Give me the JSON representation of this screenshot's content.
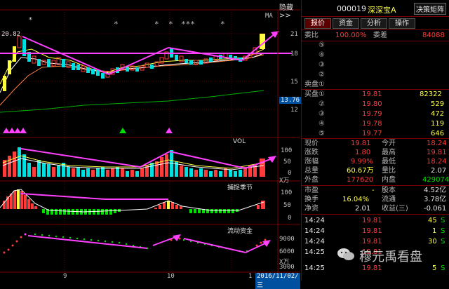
{
  "chart_header": {
    "collapse_label": "隐藏 >>"
  },
  "main_chart": {
    "price_labels": [
      "21",
      "18",
      "15",
      "12"
    ],
    "current_price_tag": "13.76",
    "high_marker": "20.82",
    "corner_label": "MA",
    "star_marks": [
      "*",
      "*",
      "*",
      "*",
      "***",
      "*"
    ]
  },
  "indicators": {
    "volume": {
      "title": "VOL",
      "ticks": [
        "100",
        "50",
        "0"
      ],
      "unit": "X万"
    },
    "seasonal": {
      "title": "捕捉季节",
      "ticks": [
        "100",
        "50",
        "0"
      ]
    },
    "capital": {
      "title": "流动资金",
      "ticks": [
        "9000",
        "6000",
        "3000"
      ],
      "unit": "X万"
    }
  },
  "x_axis": {
    "labels": [
      "9",
      "10",
      "1"
    ],
    "date_tag": "2016/11/02/三"
  },
  "stock": {
    "code": "000019",
    "name": "深深宝A",
    "decision_button": "决策矩阵"
  },
  "tabs": [
    {
      "label": "报价",
      "active": true
    },
    {
      "label": "资金",
      "active": false
    },
    {
      "label": "分析",
      "active": false
    },
    {
      "label": "操作",
      "active": false
    }
  ],
  "order_book": {
    "weibi_label": "委比",
    "weibi_value": "100.00%",
    "weicha_label": "委差",
    "weicha_value": "84088",
    "asks": [
      {
        "label": "⑤",
        "price": "",
        "vol": ""
      },
      {
        "label": "④",
        "price": "",
        "vol": ""
      },
      {
        "label": "③",
        "price": "",
        "vol": ""
      },
      {
        "label": "②",
        "price": "",
        "vol": ""
      },
      {
        "label": "卖盘①",
        "price": "",
        "vol": ""
      }
    ],
    "bids": [
      {
        "label": "买盘①",
        "price": "19.81",
        "vol": "82322"
      },
      {
        "label": "②",
        "price": "19.80",
        "vol": "529"
      },
      {
        "label": "③",
        "price": "19.79",
        "vol": "472"
      },
      {
        "label": "④",
        "price": "19.78",
        "vol": "119"
      },
      {
        "label": "⑤",
        "price": "19.77",
        "vol": "646"
      }
    ]
  },
  "quote": {
    "rows": [
      {
        "l1": "现价",
        "v1": "19.81",
        "l2": "今开",
        "v2": "18.24"
      },
      {
        "l1": "涨跌",
        "v1": "1.80",
        "l2": "最高",
        "v2": "19.81"
      },
      {
        "l1": "涨幅",
        "v1": "9.99%",
        "l2": "最低",
        "v2": "18.24"
      },
      {
        "l1": "总量",
        "v1": "60.67万",
        "l2": "量比",
        "v2": "2.07"
      },
      {
        "l1": "外盘",
        "v1": "177620",
        "l2": "内盘",
        "v2": "429074"
      }
    ]
  },
  "fundamentals": {
    "rows": [
      {
        "l1": "市盈",
        "v1": "-",
        "l2": "股本",
        "v2": "4.52亿"
      },
      {
        "l1": "换手",
        "v1": "16.04%",
        "l2": "流通",
        "v2": "3.78亿"
      },
      {
        "l1": "净资",
        "v1": "2.01",
        "l2": "收益(三)",
        "v2": "-0.061"
      }
    ]
  },
  "ticks": [
    {
      "time": "14:24",
      "price": "19.81",
      "vol": "45",
      "flag": "S"
    },
    {
      "time": "14:24",
      "price": "19.81",
      "vol": "1",
      "flag": "S"
    },
    {
      "time": "14:24",
      "price": "19.81",
      "vol": "30",
      "flag": "S"
    },
    {
      "time": "14:25",
      "price": "19.81",
      "vol": "",
      "flag": ""
    },
    {
      "time": "14:25",
      "price": "19.81",
      "vol": "5",
      "flag": "S"
    }
  ],
  "watermark": {
    "text": "穆元禹看盘"
  },
  "colors": {
    "up": "#ff3b3b",
    "down": "#00e0e0",
    "accent": "#ff40ff",
    "ma_white": "#ffffff",
    "ma_yellow": "#ffff40",
    "ma_green": "#00c000"
  }
}
